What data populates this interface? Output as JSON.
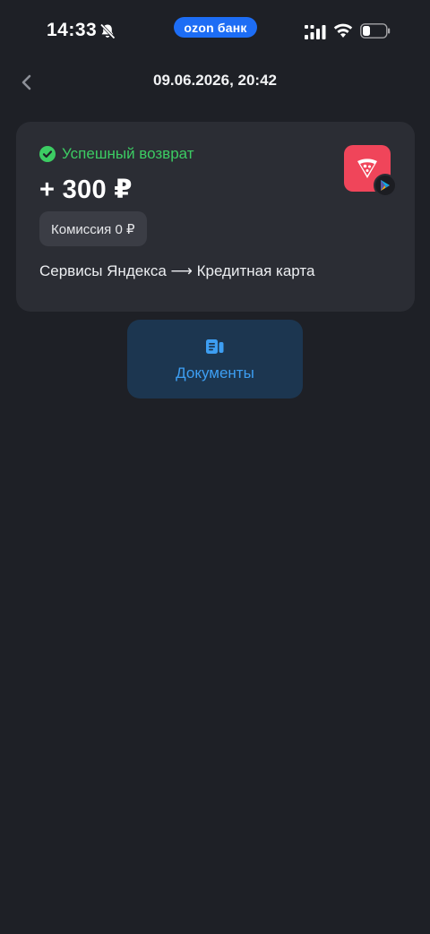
{
  "status_bar": {
    "time": "14:33",
    "carrier_badge": "ozon банк",
    "icons": [
      "bell-slash-icon",
      "signal-icon",
      "wifi-icon",
      "battery-icon"
    ]
  },
  "header": {
    "title": "09.06.2026, 20:42",
    "back_icon": "chevron-left-icon"
  },
  "operation": {
    "status": "Успешный возврат",
    "status_color": "#3ccc63",
    "amount": "+ 300 ₽",
    "commission": "Комиссия 0 ₽",
    "route": "Сервисы Яндекса ⟶ Кредитная карта",
    "logo_icon": "pizza-icon",
    "logo_color": "#f0455a"
  },
  "documents": {
    "label": "Документы",
    "icon": "document-icon",
    "color": "#3d9ef2"
  }
}
